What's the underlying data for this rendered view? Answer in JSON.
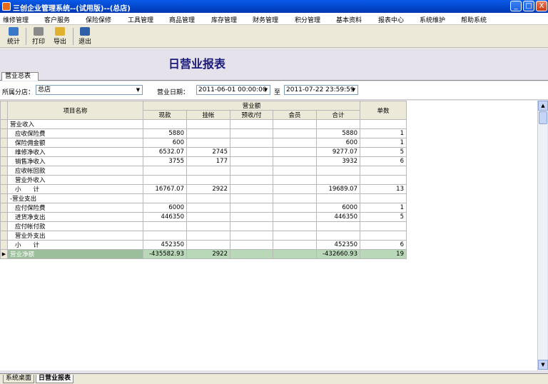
{
  "window": {
    "title": "三创企业管理系统--(试用版)--(总店)",
    "min": "_",
    "max": "□",
    "close": "X"
  },
  "menu": [
    "维修管理",
    "客户服务",
    "保险保修",
    "工具管理",
    "商品管理",
    "库存管理",
    "财务管理",
    "积分管理",
    "基本资料",
    "报表中心",
    "系统维护",
    "帮助系统"
  ],
  "toolbar": {
    "stat": "统计",
    "print": "打印",
    "export": "导出",
    "exit": "退出"
  },
  "report": {
    "title": "日营业报表"
  },
  "tab": {
    "label": "营业总表"
  },
  "filters": {
    "branch_label": "所属分店：",
    "branch_value": "总店",
    "date_label": "营业日期：",
    "date_from": "2011-06-01 00:00:00",
    "date_sep": "至",
    "date_to": "2011-07-22 23:59:59"
  },
  "table": {
    "header_name": "项目名称",
    "header_group": "营业额",
    "header_count": "单数",
    "sub_headers": [
      "现款",
      "挂帐",
      "预收/付",
      "会员",
      "合计"
    ],
    "rows": [
      {
        "name": "营业收入",
        "cash": "",
        "credit": "",
        "prepay": "",
        "member": "",
        "total": "",
        "count": ""
      },
      {
        "name": "应收保险费",
        "cash": "5880",
        "credit": "",
        "prepay": "",
        "member": "",
        "total": "5880",
        "count": "1"
      },
      {
        "name": "保险佣金额",
        "cash": "600",
        "credit": "",
        "prepay": "",
        "member": "",
        "total": "600",
        "count": "1"
      },
      {
        "name": "维修净收入",
        "cash": "6532.07",
        "credit": "2745",
        "prepay": "",
        "member": "",
        "total": "9277.07",
        "count": "5"
      },
      {
        "name": "销售净收入",
        "cash": "3755",
        "credit": "177",
        "prepay": "",
        "member": "",
        "total": "3932",
        "count": "6"
      },
      {
        "name": "应收帐回款",
        "cash": "",
        "credit": "",
        "prepay": "",
        "member": "",
        "total": "",
        "count": ""
      },
      {
        "name": "营业外收入",
        "cash": "",
        "credit": "",
        "prepay": "",
        "member": "",
        "total": "",
        "count": ""
      },
      {
        "name": "小　　计",
        "cash": "16767.07",
        "credit": "2922",
        "prepay": "",
        "member": "",
        "total": "19689.07",
        "count": "13"
      },
      {
        "name": "-营业支出",
        "cash": "",
        "credit": "",
        "prepay": "",
        "member": "",
        "total": "",
        "count": ""
      },
      {
        "name": "应付保险费",
        "cash": "6000",
        "credit": "",
        "prepay": "",
        "member": "",
        "total": "6000",
        "count": "1"
      },
      {
        "name": "进货净支出",
        "cash": "446350",
        "credit": "",
        "prepay": "",
        "member": "",
        "total": "446350",
        "count": "5"
      },
      {
        "name": "应付帐付款",
        "cash": "",
        "credit": "",
        "prepay": "",
        "member": "",
        "total": "",
        "count": ""
      },
      {
        "name": "营业外支出",
        "cash": "",
        "credit": "",
        "prepay": "",
        "member": "",
        "total": "",
        "count": ""
      },
      {
        "name": "小　　计",
        "cash": "452350",
        "credit": "",
        "prepay": "",
        "member": "",
        "total": "452350",
        "count": "6"
      }
    ],
    "total_row": {
      "indicator": "▶",
      "name": "营业净额",
      "cash": "-435582.93",
      "credit": "2922",
      "prepay": "",
      "member": "",
      "total": "-432660.93",
      "count": "19"
    }
  },
  "bottom_tabs": [
    "系统桌面",
    "日营业报表"
  ],
  "colors": {
    "title_bar": "#0245c8",
    "total_row": "#b8d8b8",
    "report_title": "#1a1a7a"
  }
}
